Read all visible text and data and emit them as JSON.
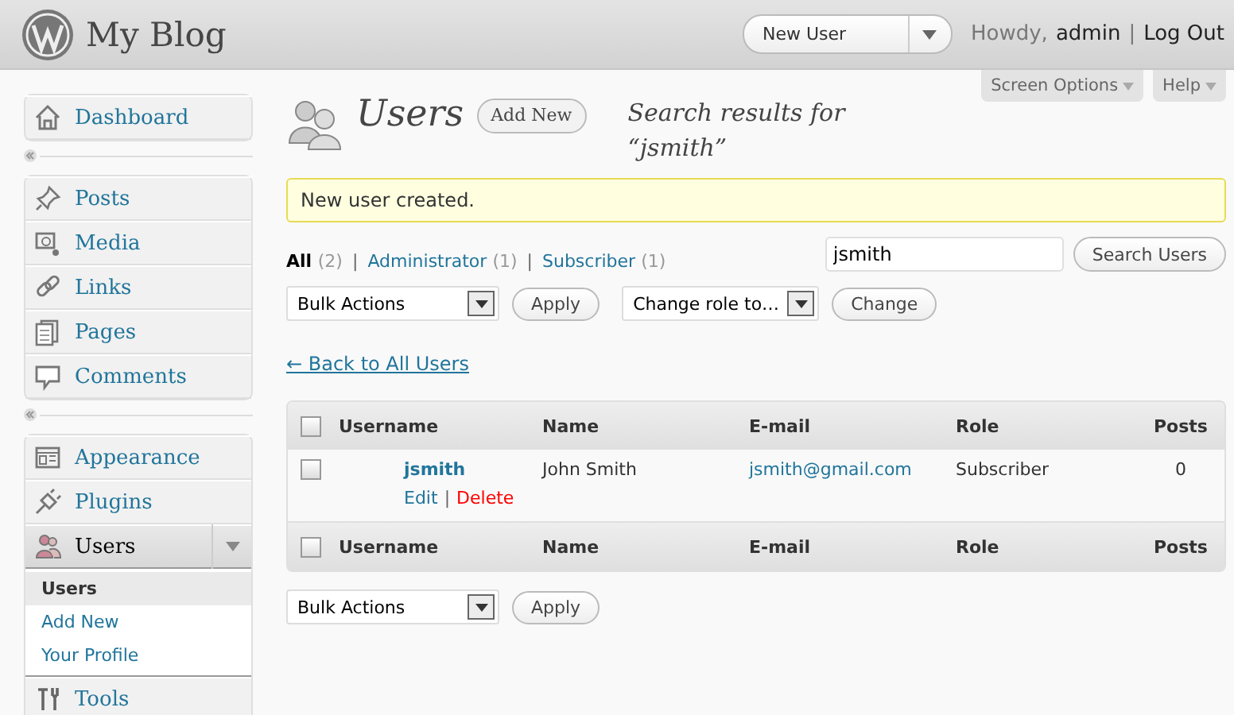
{
  "site": {
    "title": "My Blog"
  },
  "header": {
    "dropdown": "New User",
    "greeting": "Howdy,",
    "user": "admin",
    "separator": "|",
    "logout": "Log Out"
  },
  "screen_tabs": [
    {
      "label": "Screen Options"
    },
    {
      "label": "Help"
    }
  ],
  "menu": [
    {
      "items": [
        {
          "label": "Dashboard",
          "kind": "home",
          "selected": false
        }
      ]
    },
    {
      "items": [
        {
          "label": "Posts",
          "kind": "pin",
          "selected": false
        },
        {
          "label": "Media",
          "kind": "media",
          "selected": false
        },
        {
          "label": "Links",
          "kind": "link",
          "selected": false
        },
        {
          "label": "Pages",
          "kind": "pages",
          "selected": false
        },
        {
          "label": "Comments",
          "kind": "comment",
          "selected": false
        }
      ]
    },
    {
      "items": [
        {
          "label": "Appearance",
          "kind": "layout",
          "selected": false
        },
        {
          "label": "Plugins",
          "kind": "plug",
          "selected": false
        },
        {
          "label": "Users",
          "kind": "users",
          "selected": true,
          "expanded": true,
          "children": [
            {
              "label": "Users",
              "selected": true
            },
            {
              "label": "Add New",
              "selected": false
            },
            {
              "label": "Your Profile",
              "selected": false
            }
          ]
        },
        {
          "label": "Tools",
          "kind": "tools",
          "selected": false
        }
      ]
    }
  ],
  "page": {
    "title": "Users",
    "add_new": "Add New",
    "subtitle": "Search results for “jsmith”"
  },
  "notice": "New user created.",
  "filters": [
    {
      "label": "All",
      "count": "(2)",
      "selected": true
    },
    {
      "label": "Administrator",
      "count": "(1)",
      "selected": false
    },
    {
      "label": "Subscriber",
      "count": "(1)",
      "selected": false
    }
  ],
  "filter_separator": "|",
  "search": {
    "value": "jsmith",
    "button": "Search Users"
  },
  "top_actions": {
    "bulk": "Bulk Actions",
    "apply": "Apply",
    "role": "Change role to…",
    "change": "Change"
  },
  "back_link": "← Back to All Users",
  "table": {
    "select_all_checked": false,
    "columns": [
      "Username",
      "Name",
      "E-mail",
      "Role",
      "Posts"
    ],
    "rows": [
      {
        "checked": false,
        "username": "jsmith",
        "name": "John Smith",
        "email": "jsmith@gmail.com",
        "role": "Subscriber",
        "posts": "0",
        "edit": "Edit",
        "separator": "|",
        "delete": "Delete"
      }
    ],
    "footer_select_all_checked": false,
    "footer_columns": [
      "Username",
      "Name",
      "E-mail",
      "Role",
      "Posts"
    ]
  },
  "bottom_actions": {
    "bulk": "Bulk Actions",
    "apply": "Apply"
  }
}
